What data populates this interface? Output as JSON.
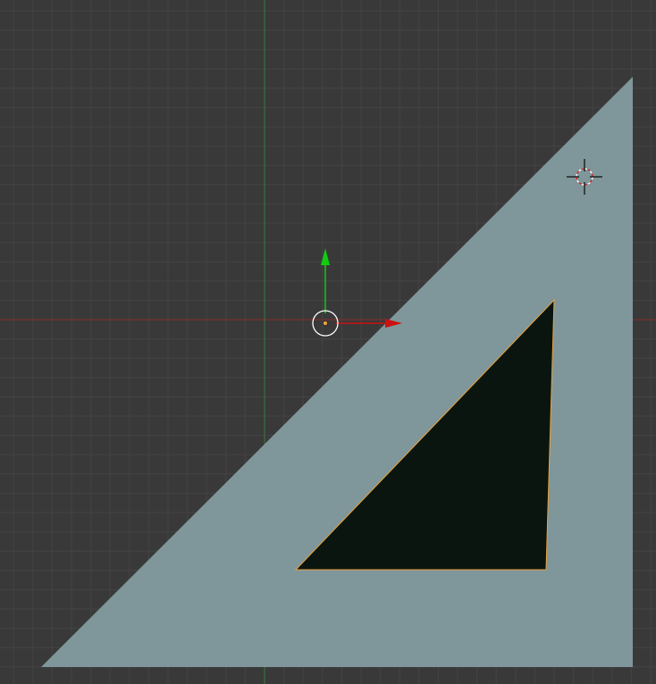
{
  "viewport": {
    "kind": "3d-viewport-top-ortho",
    "background_color": "#393939",
    "grid_color": "#444444",
    "grid_visible": true
  },
  "axes": {
    "x_axis_color": "#8a2c2c",
    "y_axis_color": "#3c7a3c"
  },
  "mesh": {
    "name": "set-square-triangle",
    "fill_color": "#7f969a",
    "hole_color": "#0b150f",
    "hole_edge_color": "#e8a33c"
  },
  "gizmo": {
    "x_arrow_color": "#cc1111",
    "y_arrow_color": "#11cc11",
    "origin_icon": "object-origin-icon"
  },
  "cursor_3d": {
    "icon": "3d-cursor-icon",
    "ring_colors": [
      "#ffffff",
      "#cc2222"
    ]
  }
}
